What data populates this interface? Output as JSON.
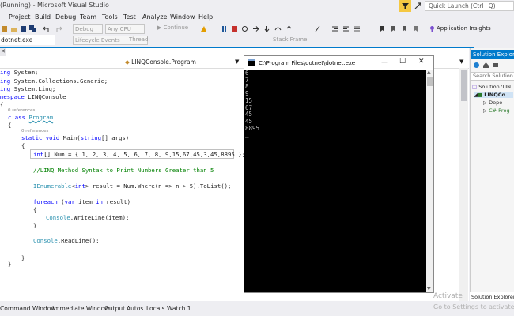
{
  "window": {
    "title": "(Running) - Microsoft Visual Studio"
  },
  "menu": [
    "Project",
    "Build",
    "Debug",
    "Team",
    "Tools",
    "Test",
    "Analyze",
    "Window",
    "Help"
  ],
  "quick_launch": {
    "placeholder": "Quick Launch (Ctrl+Q)"
  },
  "toolbar": {
    "config": "Debug",
    "platform": "Any CPU",
    "continue": "Continue",
    "lifecycle": "Lifecycle Events",
    "thread": "Thread:",
    "stack_frame": "Stack Frame:",
    "app_insights": "Application Insights"
  },
  "file_tab": "dotnet.exe",
  "editor": {
    "nav_member": "LINQConsole.Program",
    "lines": {
      "l1a": "ing ",
      "l1b": "System;",
      "l2a": "ing ",
      "l2b": "System.Collections.Generic;",
      "l3a": "ing ",
      "l3b": "System.Linq;",
      "l4a": "mespace ",
      "l4b": "LINQConsole",
      "l5": "{",
      "ref1": "0 references",
      "l6a": "class ",
      "l6b": "Program",
      "l7": "{",
      "ref2": "0 references",
      "l8a": "static void ",
      "l8b": "Main(",
      "l8c": "string",
      "l8d": "[] args)",
      "l9": "{",
      "l10a": "int",
      "l10b": "[] Num = { 1, 2, 3, 4, 5, 6, 7, 8, 9,15,67,45,3,45,8895 };",
      "l11": "//LINQ Method Syntax to Print Numbers Greater than 5",
      "l12a": "IEnumerable",
      "l12b": "<",
      "l12c": "int",
      "l12d": "> result = Num.Where(n => n > 5).ToList();",
      "l13a": "foreach",
      "l13b": " (",
      "l13c": "var",
      "l13d": " item ",
      "l13e": "in",
      "l13f": " result)",
      "l14": "{",
      "l15a": "Console",
      "l15b": ".WriteLine(item);",
      "l16": "}",
      "l17a": "Console",
      "l17b": ".ReadLine();",
      "l18": "}",
      "l19": "}"
    }
  },
  "console": {
    "title": "C:\\Program Files\\dotnet\\dotnet.exe",
    "output": [
      "6",
      "7",
      "8",
      "9",
      "15",
      "67",
      "45",
      "45",
      "8895"
    ],
    "cursor": "_"
  },
  "solution_explorer": {
    "title": "Solution Explorer",
    "search": "Search Solution E",
    "items": [
      "Solution 'LIN",
      "LINQCo",
      "Depe",
      "C# Prog"
    ]
  },
  "bottom_tabs": [
    "Command Window",
    "Immediate Window",
    "Output",
    "Autos",
    "Locals",
    "Watch 1"
  ],
  "solution_tab": "Solution Explorer",
  "watermark": {
    "line1": "Activate",
    "line2": "Go to Settings to activate Wi"
  }
}
